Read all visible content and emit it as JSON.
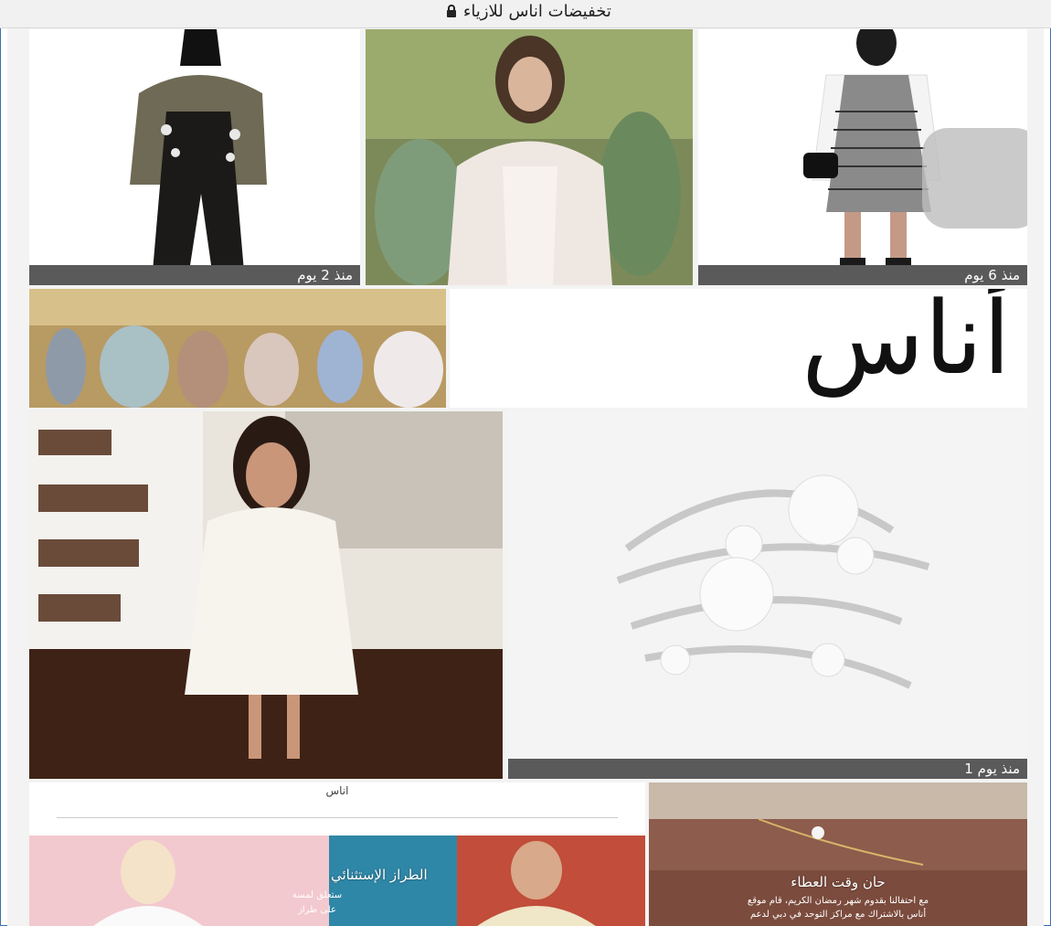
{
  "header": {
    "title": "تخفيضات اناس للازياء"
  },
  "tiles": {
    "top_left": {
      "caption": "منذ 2 يوم"
    },
    "top_right": {
      "caption": "منذ 6 يوم"
    },
    "jewelry": {
      "caption": "منذ يوم 1"
    }
  },
  "logo": {
    "text": "أناس"
  },
  "mini_site": {
    "brand": "اناس",
    "promo_title": "الطراز الإستثنائي",
    "promo_line1": "ستعلق لمسة",
    "promo_line2": "على طراز"
  },
  "promo": {
    "title": "حان وقت العطاء",
    "line1": "مع احتفالنا بقدوم شهر رمضان الكريم، قام موقع",
    "line2": "أناس بالاشتراك مع مراكز التوحد في دبي لدعم"
  },
  "icons": [
    "lock-icon"
  ],
  "colors": {
    "caption_bg": "#5a5a5a",
    "border": "#3b6fb6",
    "page_bg": "#f3f3f3"
  }
}
